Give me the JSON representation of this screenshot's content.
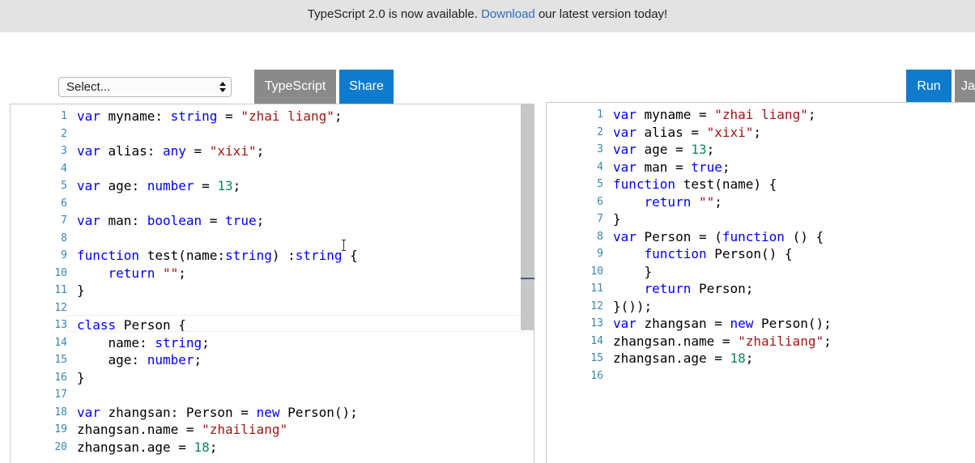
{
  "banner": {
    "pre": "TypeScript 2.0 is now available. ",
    "link": "Download",
    "post": " our latest version today!"
  },
  "toolbar": {
    "select_value": "Select...",
    "typescript_label": "TypeScript",
    "share_label": "Share",
    "run_label": "Run",
    "js_label": "Ja"
  },
  "colors": {
    "keyword": "#0000ff",
    "string": "#a31515",
    "number": "#09885a",
    "line_number": "#3a86a8",
    "button_blue": "#0f7bcd",
    "button_gray": "#8a8a8a",
    "banner_bg": "#e3e3e3"
  },
  "editor": {
    "lines": [
      [
        [
          "kw",
          "var"
        ],
        [
          "p",
          " myname: "
        ],
        [
          "ty",
          "string"
        ],
        [
          "p",
          " = "
        ],
        [
          "str",
          "\"zhai liang\""
        ],
        [
          "p",
          ";"
        ]
      ],
      [],
      [
        [
          "kw",
          "var"
        ],
        [
          "p",
          " alias: "
        ],
        [
          "ty",
          "any"
        ],
        [
          "p",
          " = "
        ],
        [
          "str",
          "\"xixi\""
        ],
        [
          "p",
          ";"
        ]
      ],
      [],
      [
        [
          "kw",
          "var"
        ],
        [
          "p",
          " age: "
        ],
        [
          "ty",
          "number"
        ],
        [
          "p",
          " = "
        ],
        [
          "num",
          "13"
        ],
        [
          "p",
          ";"
        ]
      ],
      [],
      [
        [
          "kw",
          "var"
        ],
        [
          "p",
          " man: "
        ],
        [
          "ty",
          "boolean"
        ],
        [
          "p",
          " = "
        ],
        [
          "kw",
          "true"
        ],
        [
          "p",
          ";"
        ]
      ],
      [],
      [
        [
          "kw",
          "function"
        ],
        [
          "p",
          " test(name:"
        ],
        [
          "ty",
          "string"
        ],
        [
          "p",
          ") :"
        ],
        [
          "ty",
          "string"
        ],
        [
          "p",
          " {"
        ]
      ],
      [
        [
          "p",
          "    "
        ],
        [
          "kw",
          "return"
        ],
        [
          "p",
          " "
        ],
        [
          "str",
          "\"\""
        ],
        [
          "p",
          ";"
        ]
      ],
      [
        [
          "p",
          "}"
        ]
      ],
      [],
      [
        [
          "kw",
          "class"
        ],
        [
          "p",
          " Person {"
        ]
      ],
      [
        [
          "p",
          "    name: "
        ],
        [
          "ty",
          "string"
        ],
        [
          "p",
          ";"
        ]
      ],
      [
        [
          "p",
          "    age: "
        ],
        [
          "ty",
          "number"
        ],
        [
          "p",
          ";"
        ]
      ],
      [
        [
          "p",
          "}"
        ]
      ],
      [],
      [
        [
          "kw",
          "var"
        ],
        [
          "p",
          " zhangsan: Person = "
        ],
        [
          "kw",
          "new"
        ],
        [
          "p",
          " Person();"
        ]
      ],
      [
        [
          "p",
          "zhangsan.name = "
        ],
        [
          "str",
          "\"zhailiang\""
        ]
      ],
      [
        [
          "p",
          "zhangsan.age = "
        ],
        [
          "num",
          "18"
        ],
        [
          "p",
          ";"
        ]
      ]
    ]
  },
  "output": {
    "lines": [
      [
        [
          "kw",
          "var"
        ],
        [
          "p",
          " myname = "
        ],
        [
          "str",
          "\"zhai liang\""
        ],
        [
          "p",
          ";"
        ]
      ],
      [
        [
          "kw",
          "var"
        ],
        [
          "p",
          " alias = "
        ],
        [
          "str",
          "\"xixi\""
        ],
        [
          "p",
          ";"
        ]
      ],
      [
        [
          "kw",
          "var"
        ],
        [
          "p",
          " age = "
        ],
        [
          "num",
          "13"
        ],
        [
          "p",
          ";"
        ]
      ],
      [
        [
          "kw",
          "var"
        ],
        [
          "p",
          " man = "
        ],
        [
          "kw",
          "true"
        ],
        [
          "p",
          ";"
        ]
      ],
      [
        [
          "kw",
          "function"
        ],
        [
          "p",
          " test(name) {"
        ]
      ],
      [
        [
          "p",
          "    "
        ],
        [
          "kw",
          "return"
        ],
        [
          "p",
          " "
        ],
        [
          "str",
          "\"\""
        ],
        [
          "p",
          ";"
        ]
      ],
      [
        [
          "p",
          "}"
        ]
      ],
      [
        [
          "kw",
          "var"
        ],
        [
          "p",
          " Person = ("
        ],
        [
          "kw",
          "function"
        ],
        [
          "p",
          " () {"
        ]
      ],
      [
        [
          "p",
          "    "
        ],
        [
          "kw",
          "function"
        ],
        [
          "p",
          " Person() {"
        ]
      ],
      [
        [
          "p",
          "    }"
        ]
      ],
      [
        [
          "p",
          "    "
        ],
        [
          "kw",
          "return"
        ],
        [
          "p",
          " Person;"
        ]
      ],
      [
        [
          "p",
          "}());"
        ]
      ],
      [
        [
          "kw",
          "var"
        ],
        [
          "p",
          " zhangsan = "
        ],
        [
          "kw",
          "new"
        ],
        [
          "p",
          " Person();"
        ]
      ],
      [
        [
          "p",
          "zhangsan.name = "
        ],
        [
          "str",
          "\"zhailiang\""
        ],
        [
          "p",
          ";"
        ]
      ],
      [
        [
          "p",
          "zhangsan.age = "
        ],
        [
          "num",
          "18"
        ],
        [
          "p",
          ";"
        ]
      ],
      []
    ]
  }
}
